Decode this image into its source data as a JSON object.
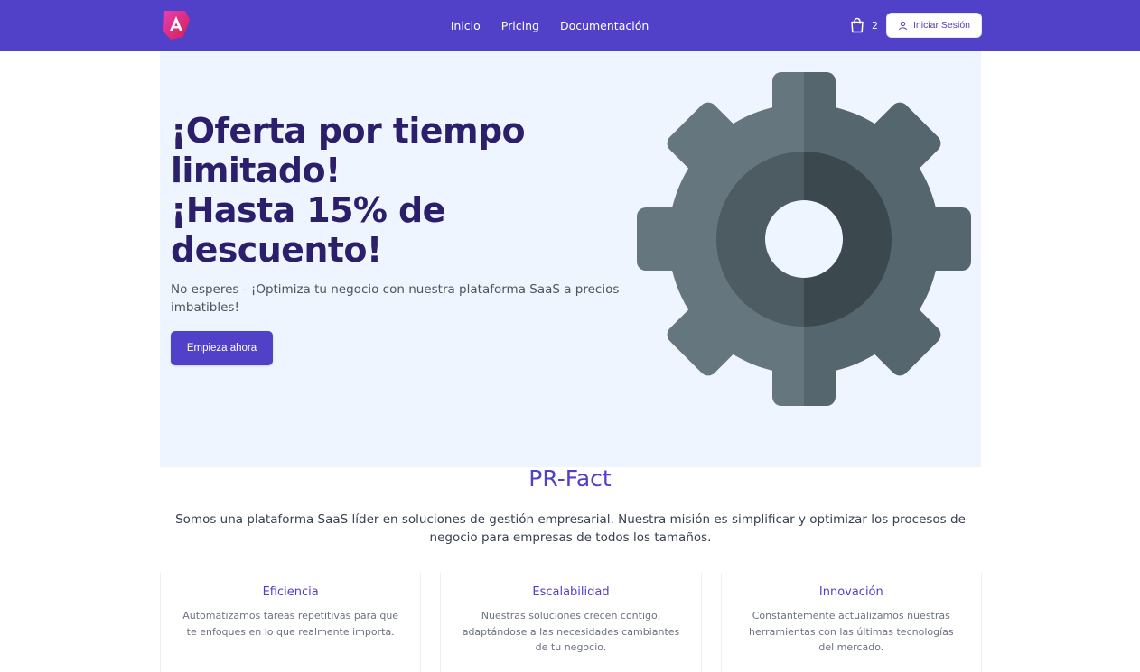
{
  "nav": {
    "links": [
      "Inicio",
      "Pricing",
      "Documentación"
    ],
    "cart_count": "2",
    "login_label": "Iniciar Sesión"
  },
  "hero": {
    "title_line1": "¡Oferta por tiempo limitado!",
    "title_line2": "¡Hasta 15% de descuento!",
    "subtitle": "No esperes - ¡Optimiza tu negocio con nuestra plataforma SaaS a precios imbatibles!",
    "cta_label": "Empieza ahora",
    "illustration": "gear-icon"
  },
  "about": {
    "title": "PR-Fact",
    "text": "Somos una plataforma SaaS líder en soluciones de gestión empresarial. Nuestra misión es simplificar y optimizar los procesos de negocio para empresas de todos los tamaños."
  },
  "features": [
    {
      "title": "Eficiencia",
      "text": "Automatizamos tareas repetitivas para que te enfoques en lo que realmente importa."
    },
    {
      "title": "Escalabilidad",
      "text": "Nuestras soluciones crecen contigo, adaptándose a las necesidades cambiantes de tu negocio."
    },
    {
      "title": "Innovación",
      "text": "Constantemente actualizamos nuestras herramientas con las últimas tecnologías del mercado."
    }
  ],
  "colors": {
    "brand": "#5140c8",
    "hero_bg": "#eff5fe",
    "hero_title": "#2b1f6b",
    "gear_light": "#66767f",
    "gear_dark": "#55666f",
    "gear_inner_light": "#4d5b63",
    "gear_inner_dark": "#3b494f"
  }
}
